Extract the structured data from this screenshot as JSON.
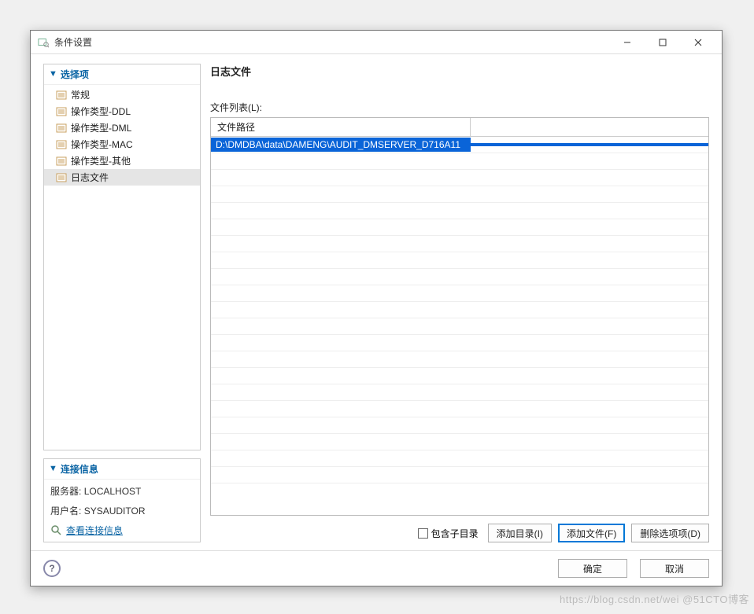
{
  "window": {
    "title": "条件设置"
  },
  "sidebar": {
    "header": "选择项",
    "items": [
      {
        "label": "常规"
      },
      {
        "label": "操作类型-DDL"
      },
      {
        "label": "操作类型-DML"
      },
      {
        "label": "操作类型-MAC"
      },
      {
        "label": "操作类型-其他"
      },
      {
        "label": "日志文件"
      }
    ],
    "selected_index": 5
  },
  "connection": {
    "header": "连接信息",
    "server_label": "服务器:",
    "server_value": "LOCALHOST",
    "user_label": "用户名:",
    "user_value": "SYSAUDITOR",
    "link_label": "查看连接信息"
  },
  "main": {
    "title": "日志文件",
    "list_label": "文件列表(L):",
    "columns": {
      "path": "文件路径",
      "col2": ""
    },
    "rows": [
      {
        "path": "D:\\DMDBA\\data\\DAMENG\\AUDIT_DMSERVER_D716A11"
      }
    ],
    "actions": {
      "include_sub_label": "包含子目录",
      "add_dir": "添加目录(I)",
      "add_file": "添加文件(F)",
      "remove": "删除选项项(D)"
    }
  },
  "footer": {
    "ok": "确定",
    "cancel": "取消",
    "help": "?"
  },
  "watermark": "https://blog.csdn.net/wei @51CTO博客"
}
